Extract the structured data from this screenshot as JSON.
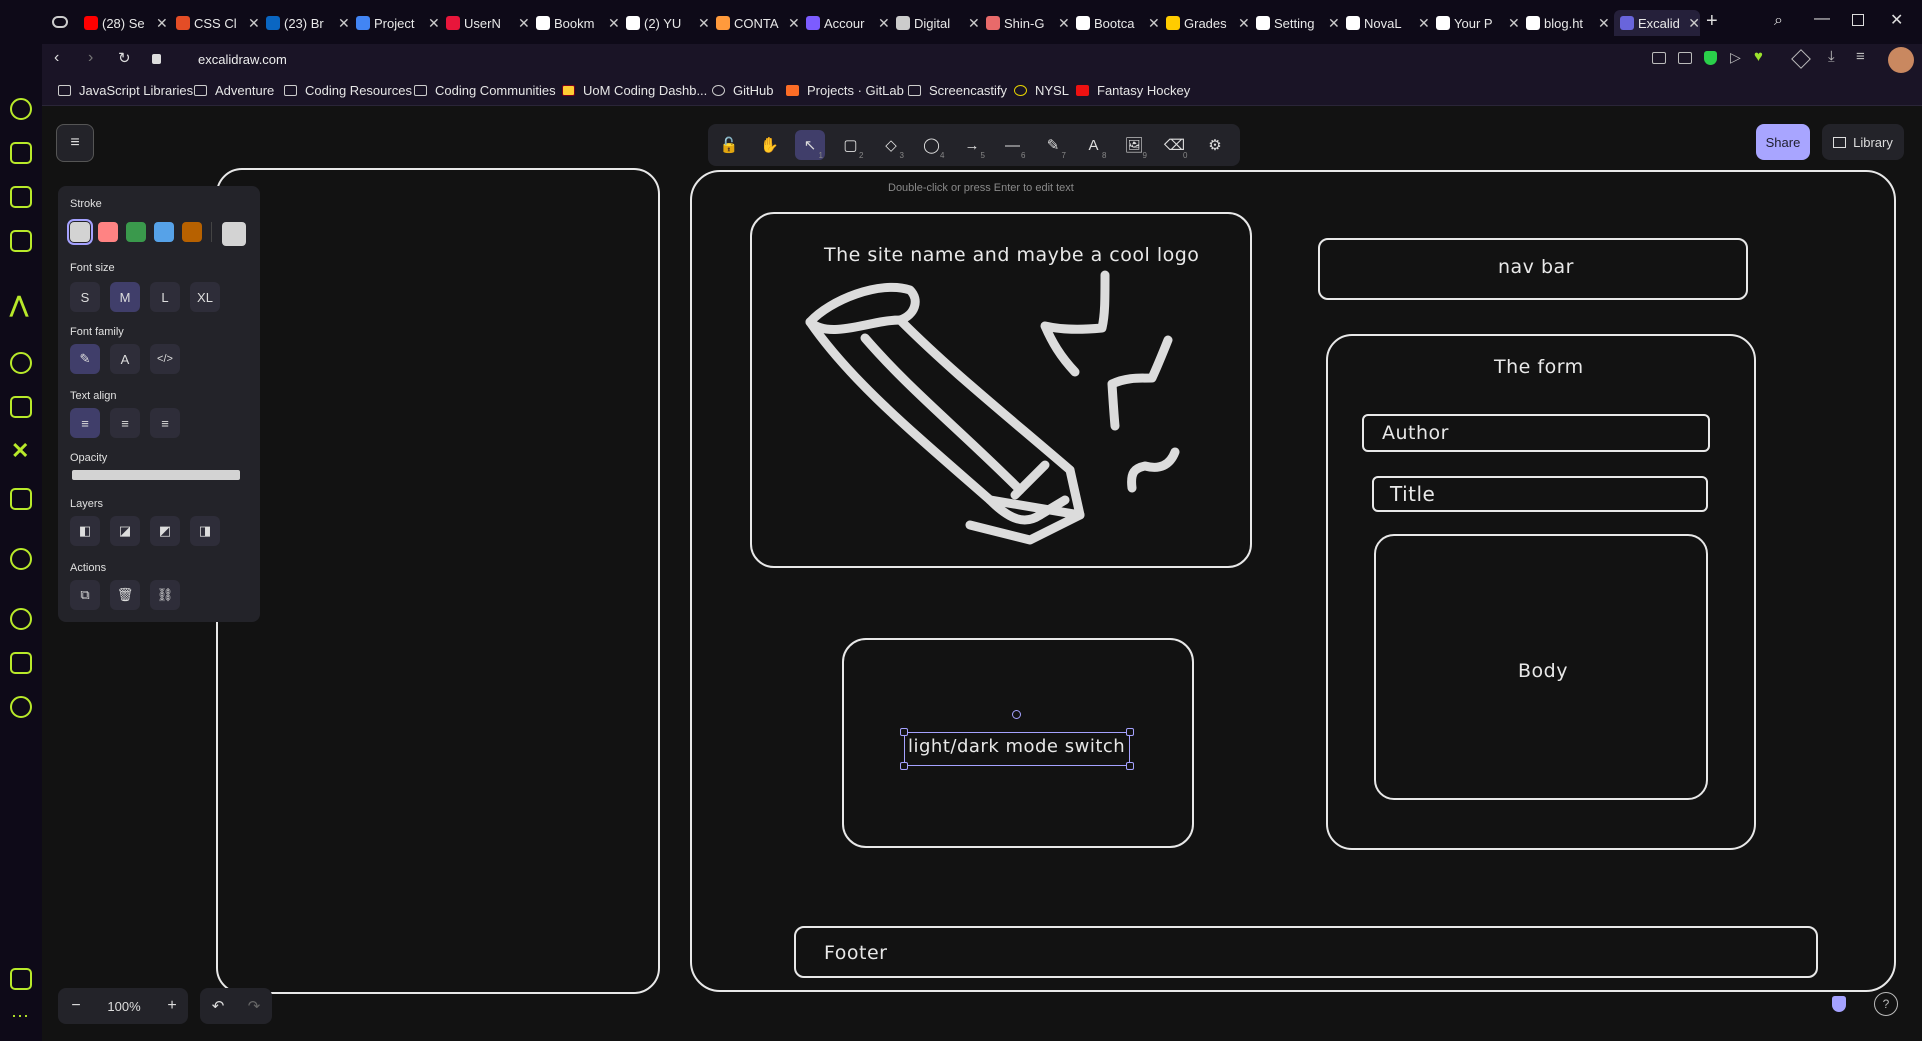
{
  "browser": {
    "tabs": [
      {
        "label": "(28) Se",
        "icon_color": "#ff0000"
      },
      {
        "label": "CSS Cl",
        "icon_color": "#e44d26"
      },
      {
        "label": "(23) Br",
        "icon_color": "#0a66c2"
      },
      {
        "label": "Project",
        "icon_color": "#4285f4"
      },
      {
        "label": "UserN",
        "icon_color": "#e8163b"
      },
      {
        "label": "Bookm",
        "icon_color": "#ffffff"
      },
      {
        "label": "(2) YU",
        "icon_color": "#ffffff"
      },
      {
        "label": "CONTA",
        "icon_color": "#ff9a3c"
      },
      {
        "label": "Accour",
        "icon_color": "#7c5cff"
      },
      {
        "label": "Digital",
        "icon_color": "#cccccc"
      },
      {
        "label": "Shin-G",
        "icon_color": "#e86a6a"
      },
      {
        "label": "Bootca",
        "icon_color": "#ffffff"
      },
      {
        "label": "Grades",
        "icon_color": "#ffcc00"
      },
      {
        "label": "Setting",
        "icon_color": "#ffffff"
      },
      {
        "label": "NovaL",
        "icon_color": "#ffffff"
      },
      {
        "label": "Your P",
        "icon_color": "#ffffff"
      },
      {
        "label": "blog.ht",
        "icon_color": "#ffffff"
      },
      {
        "label": "Excalid",
        "icon_color": "#6965db"
      }
    ],
    "url": "excalidraw.com",
    "bookmarks": [
      "JavaScript Libraries",
      "Adventure",
      "Coding Resources",
      "Coding Communities",
      "UoM Coding Dashb...",
      "GitHub",
      "Projects · GitLab",
      "Screencastify",
      "NYSL",
      "Fantasy Hockey"
    ]
  },
  "excalidraw": {
    "share_label": "Share",
    "library_label": "Library",
    "hint": "Double-click or press Enter to edit text",
    "zoom": "100%",
    "tools": [
      {
        "icon": "lock-icon",
        "num": ""
      },
      {
        "icon": "hand-icon",
        "num": ""
      },
      {
        "icon": "selection-icon",
        "num": "1"
      },
      {
        "icon": "rectangle-icon",
        "num": "2"
      },
      {
        "icon": "diamond-icon",
        "num": "3"
      },
      {
        "icon": "ellipse-icon",
        "num": "4"
      },
      {
        "icon": "arrow-icon",
        "num": "5"
      },
      {
        "icon": "line-icon",
        "num": "6"
      },
      {
        "icon": "pencil-icon",
        "num": "7"
      },
      {
        "icon": "text-icon",
        "num": "8"
      },
      {
        "icon": "image-icon",
        "num": "9"
      },
      {
        "icon": "eraser-icon",
        "num": "0"
      },
      {
        "icon": "extra-tools-icon",
        "num": ""
      }
    ],
    "panel": {
      "stroke_label": "Stroke",
      "stroke_colors": [
        "#d3d3d3",
        "#ff8383",
        "#3a994c",
        "#56a2e8",
        "#b76100"
      ],
      "current_stroke": "#d3d3d3",
      "font_size_label": "Font size",
      "font_sizes": [
        "S",
        "M",
        "L",
        "XL"
      ],
      "font_family_label": "Font family",
      "text_align_label": "Text align",
      "opacity_label": "Opacity",
      "layers_label": "Layers",
      "actions_label": "Actions"
    },
    "drawing": {
      "logo_text": "The site name and maybe a cool logo",
      "nav_text": "nav bar",
      "form_title": "The form",
      "author_text": "Author",
      "title_text": "Title",
      "body_text": "Body",
      "switch_text": "light/dark mode switch",
      "footer_text": "Footer"
    }
  }
}
